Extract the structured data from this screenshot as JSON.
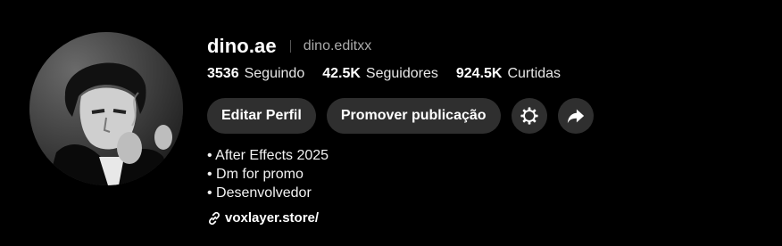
{
  "profile": {
    "display_name": "dino.ae",
    "username": "dino.editxx",
    "stats": [
      {
        "value": "3536",
        "label": "Seguindo"
      },
      {
        "value": "42.5K",
        "label": "Seguidores"
      },
      {
        "value": "924.5K",
        "label": "Curtidas"
      }
    ],
    "actions": {
      "edit_label": "Editar Perfil",
      "promote_label": "Promover publicação",
      "settings_icon": "gear-icon",
      "share_icon": "share-arrow-icon"
    },
    "bio": [
      "• After Effects 2025",
      "• Dm for promo",
      "• Desenvolvedor"
    ],
    "link": {
      "icon": "link-icon",
      "text": "voxlayer.store/"
    }
  },
  "colors": {
    "background": "#000000",
    "button_bg": "#2f2f2f",
    "muted_text": "#aaaaaa"
  }
}
